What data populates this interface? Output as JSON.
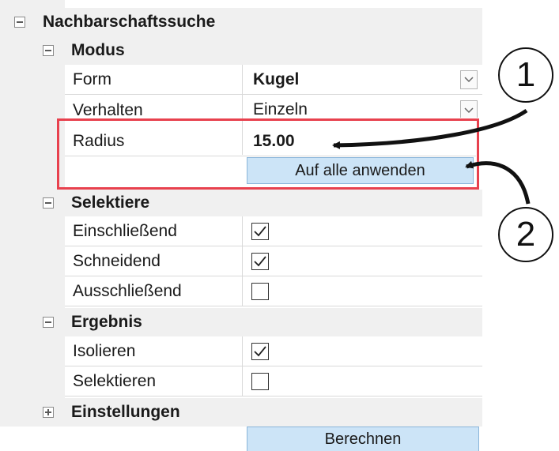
{
  "panel": {
    "title": "Nachbarschaftssuche",
    "modus": {
      "header": "Modus",
      "form_label": "Form",
      "form_value": "Kugel",
      "verhalten_label": "Verhalten",
      "verhalten_value": "Einzeln",
      "radius_label": "Radius",
      "radius_value": "15.00",
      "apply_all_label": "Auf alle anwenden"
    },
    "selektiere": {
      "header": "Selektiere",
      "items": [
        {
          "label": "Einschließend",
          "checked": true
        },
        {
          "label": "Schneidend",
          "checked": true
        },
        {
          "label": "Ausschließend",
          "checked": false
        }
      ]
    },
    "ergebnis": {
      "header": "Ergebnis",
      "items": [
        {
          "label": "Isolieren",
          "checked": true
        },
        {
          "label": "Selektieren",
          "checked": false
        }
      ]
    },
    "einstellungen": {
      "header": "Einstellungen"
    },
    "calculate_label": "Berechnen"
  },
  "callouts": {
    "one": "1",
    "two": "2"
  },
  "colors": {
    "highlight": "#e8414e",
    "button_bg": "#cce4f7",
    "band_bg": "#f0f0f0"
  }
}
